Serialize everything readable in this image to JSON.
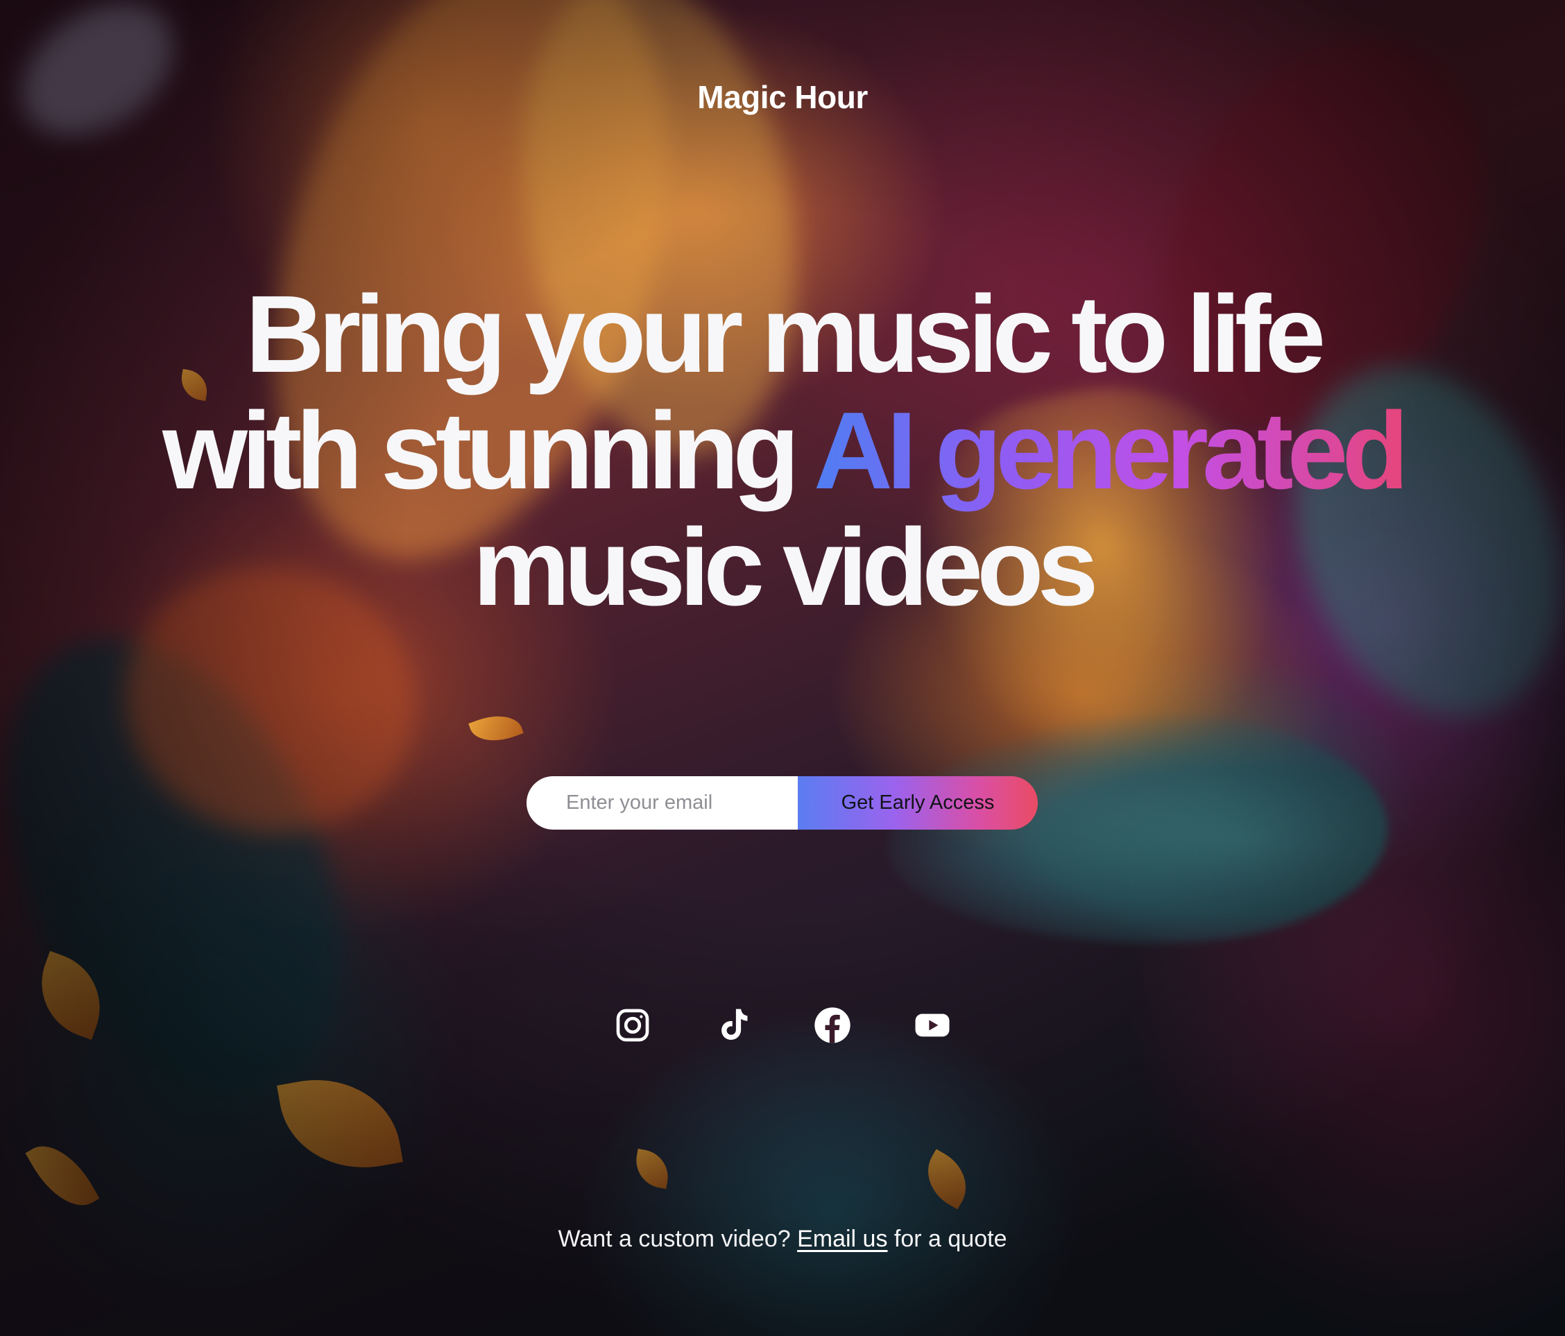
{
  "header": {
    "brand": "Magic Hour"
  },
  "hero": {
    "line1": "Bring your music to life",
    "line2_plain": "with stunning ",
    "line2_highlight": "AI generated",
    "line3": "music videos"
  },
  "signup": {
    "email_placeholder": "Enter your email",
    "email_value": "",
    "button_label": "Get Early Access"
  },
  "socials": [
    {
      "name": "Instagram",
      "icon": "instagram-icon"
    },
    {
      "name": "TikTok",
      "icon": "tiktok-icon"
    },
    {
      "name": "Facebook",
      "icon": "facebook-icon"
    },
    {
      "name": "YouTube",
      "icon": "youtube-icon"
    }
  ],
  "footer": {
    "prefix": "Want a custom video? ",
    "link_label": "Email us",
    "suffix": " for a quote"
  },
  "colors": {
    "gradient_start": "#4f7ef2",
    "gradient_mid": "#c24fe6",
    "gradient_end": "#e6457c",
    "text": "#ffffff",
    "input_bg": "#ffffff"
  }
}
